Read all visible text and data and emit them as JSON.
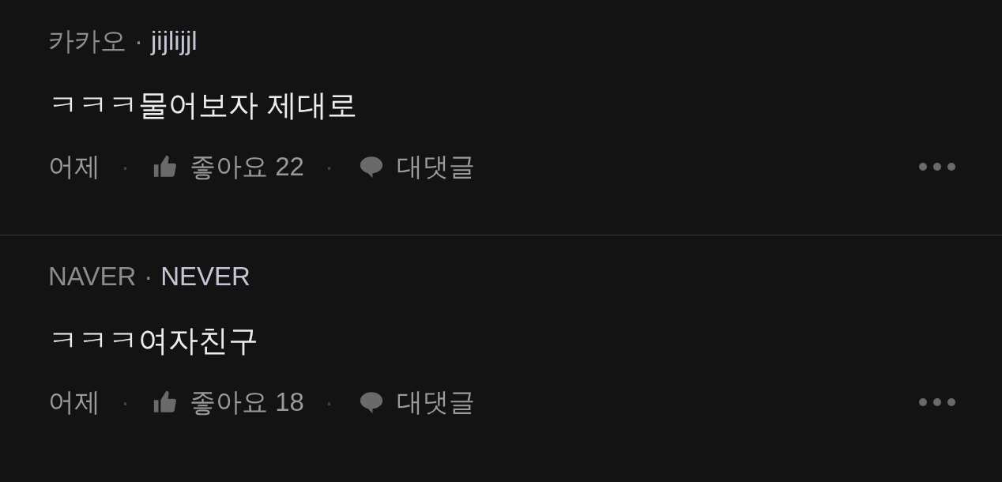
{
  "comments": [
    {
      "source": "카카오",
      "separator": "·",
      "author": "jijlijjl",
      "text": "ㅋㅋㅋ물어보자 제대로",
      "time": "어제",
      "like_label": "좋아요 22",
      "reply_label": "대댓글",
      "footer_separator": "·"
    },
    {
      "source": "NAVER",
      "separator": "·",
      "author": "NEVER",
      "text": "ㅋㅋㅋ여자친구",
      "time": "어제",
      "like_label": "좋아요 18",
      "reply_label": "대댓글",
      "footer_separator": "·"
    }
  ]
}
